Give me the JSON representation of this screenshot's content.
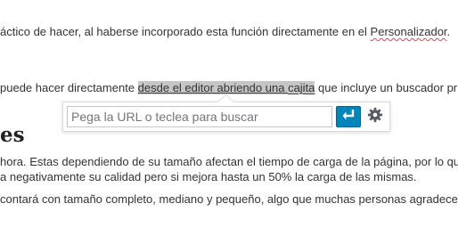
{
  "article": {
    "line1": {
      "before": "áctico de hacer, al haberse incorporado esta función directamente en el ",
      "squiggle": "Personalizador",
      "after": "."
    },
    "line2": {
      "before": " puede hacer directamente ",
      "selected_a": "desde el editor abriendo una ",
      "selected_squiggle": "cajita",
      "after": " que incluye un buscador pr"
    },
    "heading": "es",
    "line3": "hora. Estas dependiendo de su tamaño afectan el tiempo de carga de la página, por lo qu",
    "line4": "a negativamente su calidad pero si mejora hasta un 50% la carga de las mismas.",
    "line5": " contará con tamaño completo, mediano y pequeño, algo que muchas personas agradece"
  },
  "link_popover": {
    "input_placeholder": "Pega la URL o teclea para buscar",
    "input_value": "",
    "apply_icon": "enter-arrow-icon",
    "settings_icon": "gear-icon",
    "colors": {
      "apply_bg": "#0085ba",
      "icon_gray": "#555d66"
    }
  }
}
